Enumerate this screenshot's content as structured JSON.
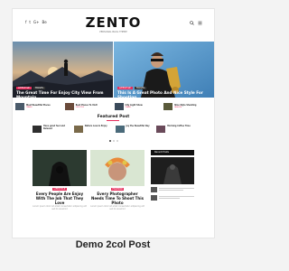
{
  "header": {
    "logo": "ZENTO",
    "tagline": "PERSONAL BLOG THEME",
    "socials": [
      "f",
      "t",
      "G+",
      "Be"
    ]
  },
  "hero": [
    {
      "title": "The Great Time For Enjoy City View From Mountain",
      "cats": [
        "LIFESTYLE",
        "TRAVEL"
      ]
    },
    {
      "title": "This Is A Great Photo And Nice Style For Shooting",
      "cats": [
        "LIFESTYLE",
        "TRAVEL"
      ]
    }
  ],
  "thumb_row": [
    {
      "title": "Most Beautiful Places",
      "cat": "TRAVEL"
    },
    {
      "title": "Best Places To Visit",
      "cat": "LIFESTYLE"
    },
    {
      "title": "City Light Show",
      "cat": "TRAVEL"
    },
    {
      "title": "Nice Style Shooting",
      "cat": "FASHION"
    }
  ],
  "featured": {
    "title": "Featured Post",
    "items": [
      {
        "title": "Have good feel and Relaxed"
      },
      {
        "title": "Nature Lovers Enjoy"
      },
      {
        "title": "Joy the Beautiful Day"
      },
      {
        "title": "Morning Coffee Time"
      }
    ]
  },
  "posts": [
    {
      "cat": "LIFESTYLE",
      "title": "Every People Are Enjoy With The Job That They Love",
      "excerpt": "Lorem ipsum dolor sit amet consectetur adipiscing elit sed do eiusmod"
    },
    {
      "cat": "FASHION",
      "title": "Every Photographer Needs Time To Shoot This Photo",
      "excerpt": "Lorem ipsum dolor sit amet consectetur adipiscing elit sed do eiusmod"
    }
  ],
  "sidebar": {
    "title": "Recent Posts"
  },
  "caption": "Demo 2col Post",
  "colors": {
    "accent": "#e62e5c",
    "dark": "#111111"
  }
}
